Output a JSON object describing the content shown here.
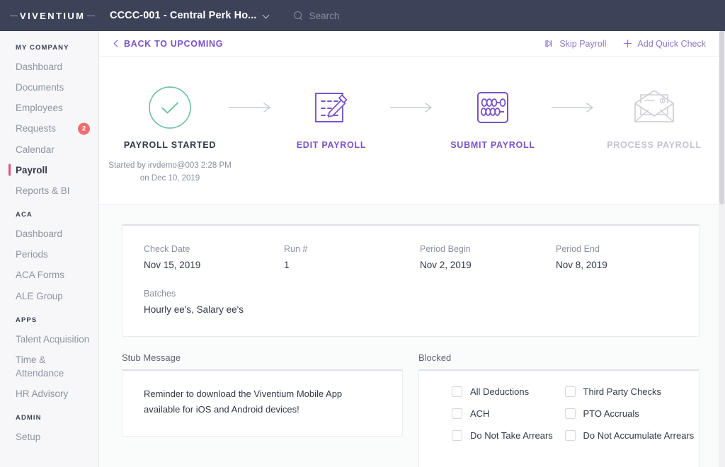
{
  "topbar": {
    "logo_text": "VIVENTIUM",
    "logo_icon": "viventium-logo",
    "company": "CCCC-001 - Central Perk Ho...",
    "company_chevron_icon": "chevron-down-icon",
    "search_icon": "search-icon",
    "search_placeholder": "Search"
  },
  "sidebar": {
    "groups": [
      {
        "heading": "MY COMPANY",
        "items": [
          {
            "label": "Dashboard",
            "active": false,
            "badge": ""
          },
          {
            "label": "Documents",
            "active": false,
            "badge": ""
          },
          {
            "label": "Employees",
            "active": false,
            "badge": ""
          },
          {
            "label": "Requests",
            "active": false,
            "badge": "2"
          },
          {
            "label": "Calendar",
            "active": false,
            "badge": ""
          },
          {
            "label": "Payroll",
            "active": true,
            "badge": ""
          },
          {
            "label": "Reports & BI",
            "active": false,
            "badge": ""
          }
        ]
      },
      {
        "heading": "ACA",
        "items": [
          {
            "label": "Dashboard",
            "active": false,
            "badge": ""
          },
          {
            "label": "Periods",
            "active": false,
            "badge": ""
          },
          {
            "label": "ACA Forms",
            "active": false,
            "badge": ""
          },
          {
            "label": "ALE Group",
            "active": false,
            "badge": ""
          }
        ]
      },
      {
        "heading": "APPS",
        "items": [
          {
            "label": "Talent Acquisition",
            "active": false,
            "badge": ""
          },
          {
            "label": "Time & Attendance",
            "active": false,
            "badge": ""
          },
          {
            "label": "HR Advisory",
            "active": false,
            "badge": ""
          }
        ]
      },
      {
        "heading": "ADMIN",
        "items": [
          {
            "label": "Setup",
            "active": false,
            "badge": ""
          }
        ]
      }
    ]
  },
  "action_bar": {
    "back_label": "BACK TO UPCOMING",
    "back_icon": "chevron-left-icon",
    "skip_label": "Skip Payroll",
    "skip_icon": "skip-forward-icon",
    "quick_check_label": "Add Quick Check",
    "quick_check_icon": "plus-icon"
  },
  "stepper": {
    "steps": [
      {
        "label": "PAYROLL STARTED",
        "icon": "check-circle-icon",
        "state": "done"
      },
      {
        "label": "EDIT PAYROLL",
        "icon": "edit-pencil-icon",
        "state": "active"
      },
      {
        "label": "SUBMIT PAYROLL",
        "icon": "abacus-icon",
        "state": "active"
      },
      {
        "label": "PROCESS PAYROLL",
        "icon": "envelope-check-icon",
        "state": "pending"
      }
    ],
    "arrow_icon": "arrow-right-icon",
    "started_by": "Started by irvdemo@003 2:28 PM on Dec 10, 2019"
  },
  "details": {
    "check_date_label": "Check Date",
    "check_date_value": "Nov 15, 2019",
    "run_label": "Run #",
    "run_value": "1",
    "period_begin_label": "Period Begin",
    "period_begin_value": "Nov 2, 2019",
    "period_end_label": "Period End",
    "period_end_value": "Nov 8, 2019",
    "batches_label": "Batches",
    "batches_value": "Hourly ee's, Salary ee's"
  },
  "stub_message": {
    "title": "Stub Message",
    "text": "Reminder to download the Viventium Mobile App available for iOS and Android devices!"
  },
  "blocked": {
    "title": "Blocked",
    "options": [
      {
        "label": "All Deductions",
        "checked": false
      },
      {
        "label": "Third Party Checks",
        "checked": false
      },
      {
        "label": "ACH",
        "checked": false
      },
      {
        "label": "PTO Accruals",
        "checked": false
      },
      {
        "label": "Do Not Take Arrears",
        "checked": false
      },
      {
        "label": "Do Not Accumulate Arrears",
        "checked": false
      }
    ]
  },
  "colors": {
    "topbar_bg": "#3c4257",
    "accent_purple": "#7a52cc",
    "active_marker_pink": "#e0547c",
    "badge_red": "#ef6e72",
    "success_green": "#74c4a3",
    "pending_gray": "#c2c4cd"
  }
}
